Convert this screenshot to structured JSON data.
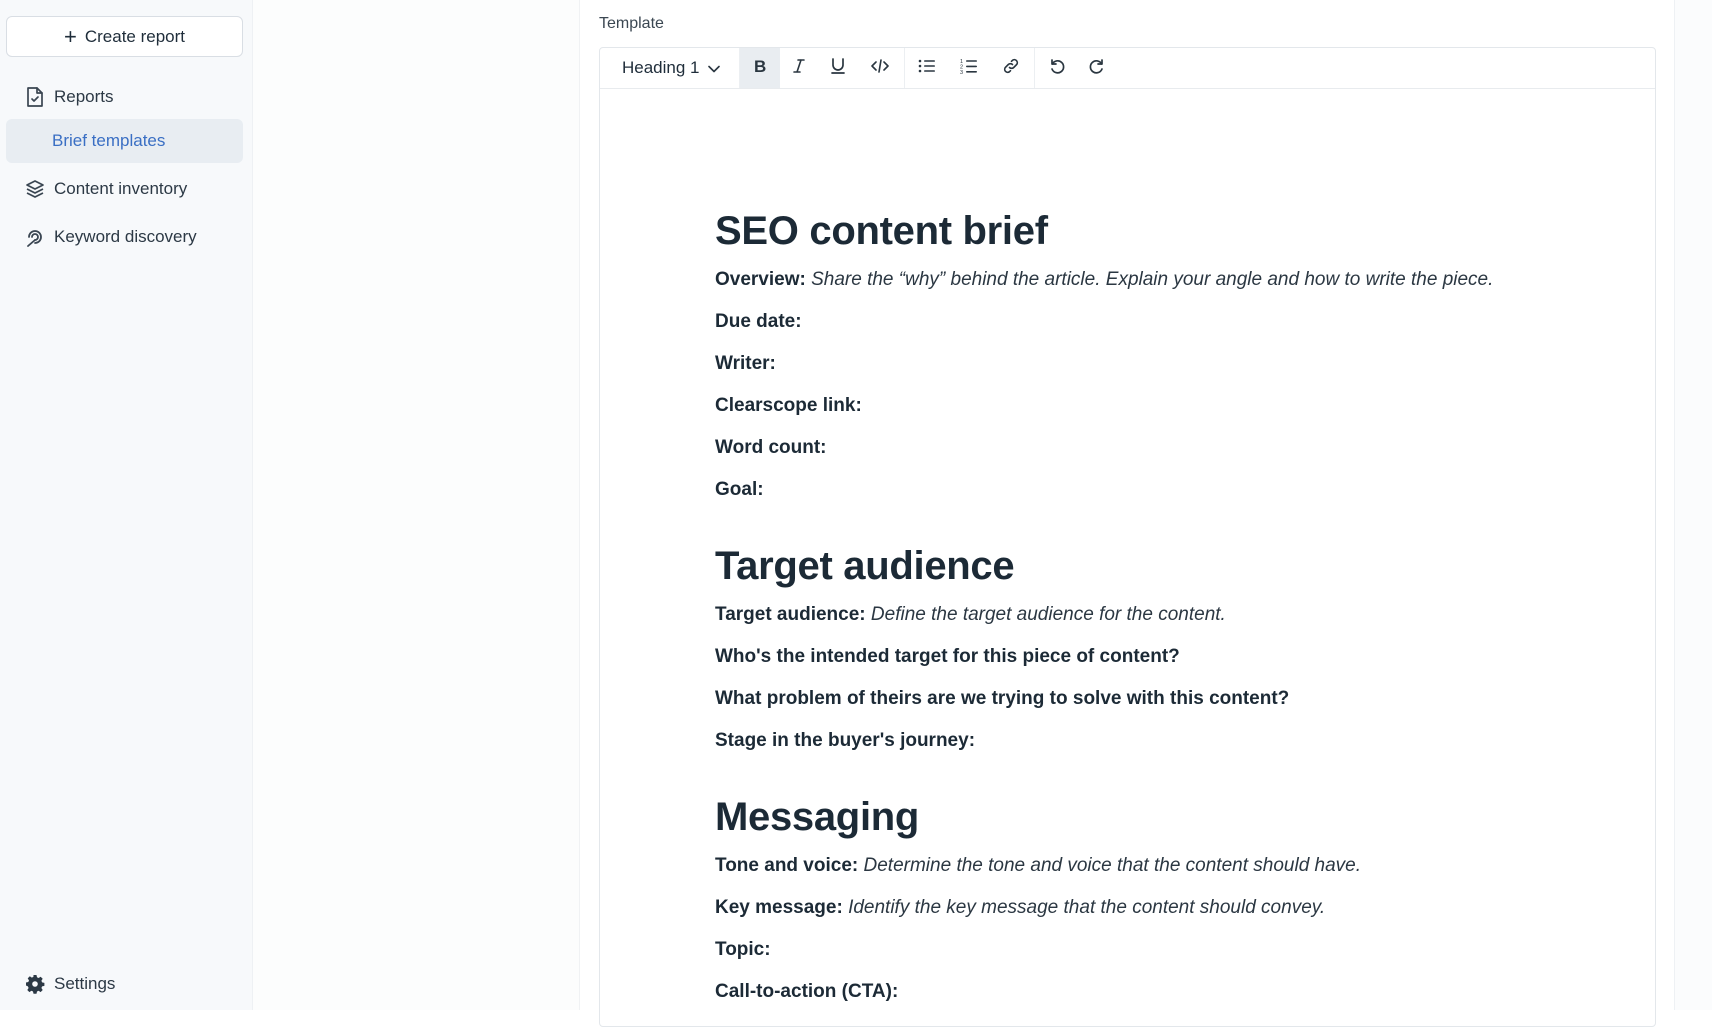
{
  "sidebar": {
    "create_button": "Create report",
    "items": [
      {
        "label": "Reports",
        "icon": "file-check-icon"
      },
      {
        "label": "Brief templates",
        "icon": ""
      },
      {
        "label": "Content inventory",
        "icon": "layers-icon"
      },
      {
        "label": "Keyword discovery",
        "icon": "keyword-icon"
      }
    ],
    "settings_label": "Settings"
  },
  "main": {
    "section_label": "Template",
    "toolbar": {
      "block_type": "Heading 1",
      "buttons": [
        "bold",
        "italic",
        "underline",
        "code",
        "bullet-list",
        "numbered-list",
        "link",
        "undo",
        "redo"
      ]
    },
    "document": {
      "title": "SEO content brief",
      "overview_label": "Overview:",
      "overview_text": "Share the “why” behind the article. Explain your angle and how to write the piece.",
      "due_date": "Due date:",
      "writer": "Writer:",
      "clearscope_link": "Clearscope link:",
      "word_count": "Word count:",
      "goal": "Goal:",
      "audience_heading": "Target audience",
      "target_audience_label": "Target audience:",
      "target_audience_text": "Define the target audience for the content.",
      "intended_target": "Who's the intended target for this piece of content?",
      "problem": "What problem of theirs are we trying to solve with this content?",
      "stage": "Stage in the buyer's journey:",
      "messaging_heading": "Messaging",
      "tone_label": "Tone and voice:",
      "tone_text": "Determine the tone and voice that the content should have.",
      "key_message_label": "Key message:",
      "key_message_text": "Identify the key message that the content should convey.",
      "topic": "Topic:",
      "cta": "Call-to-action (CTA):"
    }
  }
}
